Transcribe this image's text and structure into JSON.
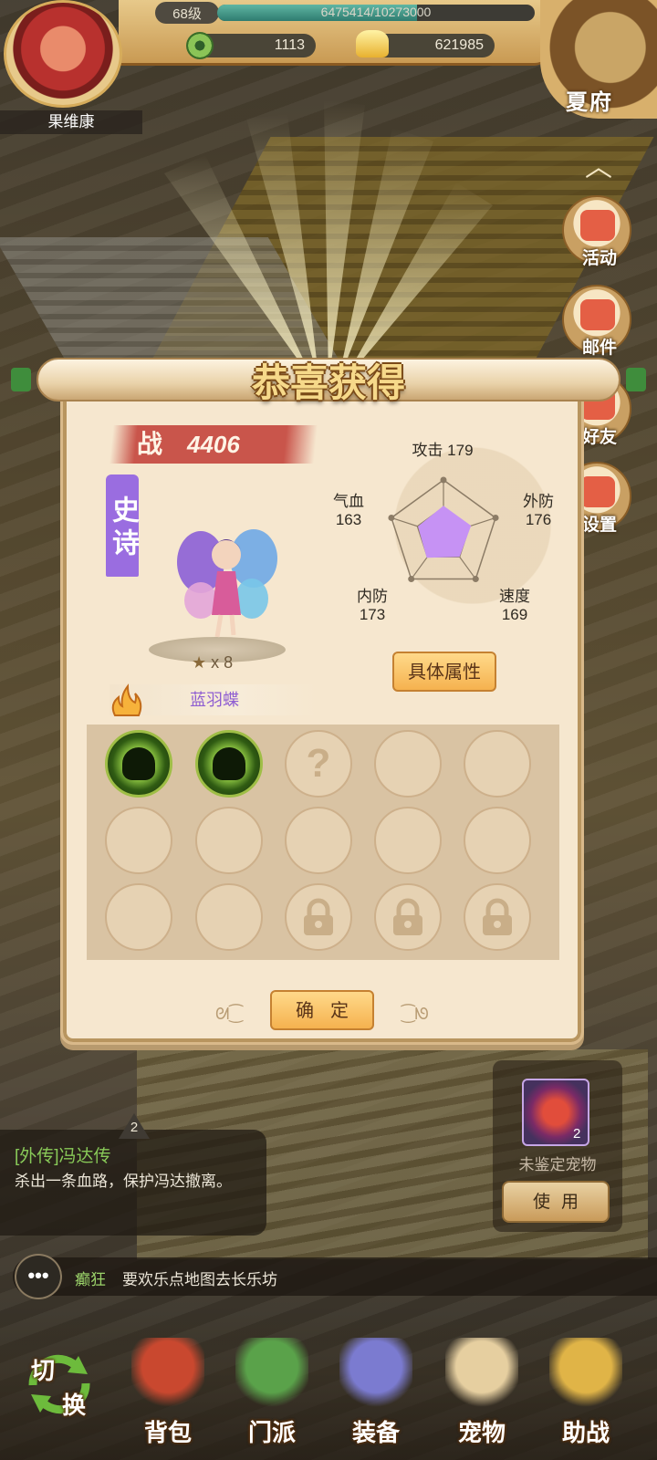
{
  "player": {
    "name": "果维康",
    "level": "68级",
    "exp_text": "6475414/10273000",
    "exp_fraction": 0.63,
    "currency_copper": "1113",
    "currency_gold": "621985"
  },
  "palace": {
    "label": "夏府"
  },
  "side_menu": [
    {
      "label": "活动",
      "icon": "drum-icon"
    },
    {
      "label": "邮件",
      "icon": "envelope-icon"
    },
    {
      "label": "好友",
      "icon": "friends-icon"
    },
    {
      "label": "设置",
      "icon": "gear-icon"
    }
  ],
  "popup": {
    "title": "恭喜获得",
    "power_label": "战",
    "power_value": "4406",
    "rarity": "史诗",
    "stars": "x 8",
    "pet_name": "蓝羽蝶",
    "stats": {
      "attack": {
        "label": "攻击",
        "value": "179"
      },
      "outer_defense": {
        "label": "外防",
        "value": "176"
      },
      "speed": {
        "label": "速度",
        "value": "169"
      },
      "inner_defense": {
        "label": "内防",
        "value": "173"
      },
      "hp": {
        "label": "气血",
        "value": "163"
      }
    },
    "radar_fraction": {
      "attack": 0.53,
      "outer_defense": 0.53,
      "speed": 0.5,
      "inner_defense": 0.52,
      "hp": 0.49
    },
    "attr_button": "具体属性",
    "confirm_button": "确定",
    "skills": {
      "rows": [
        [
          "skill",
          "skill",
          "unknown",
          "empty",
          "empty"
        ],
        [
          "empty",
          "empty",
          "empty",
          "empty",
          "empty"
        ],
        [
          "empty",
          "empty",
          "locked",
          "locked",
          "locked"
        ]
      ]
    }
  },
  "quest": {
    "badge": "2",
    "title": "[外传]冯达传",
    "desc": "杀出一条血路，保护冯达撤离。"
  },
  "pet_item": {
    "count": "2",
    "label": "未鉴定宠物",
    "use_button": "使用"
  },
  "chat": {
    "speaker": "癫狂",
    "text": "要欢乐点地图去长乐坊"
  },
  "nav": {
    "switch_top": "切",
    "switch_bottom": "换",
    "items": [
      {
        "label": "背包",
        "icon": "bag-icon",
        "color": "#c9482f"
      },
      {
        "label": "门派",
        "icon": "sect-icon",
        "color": "#5aa24a"
      },
      {
        "label": "装备",
        "icon": "sword-icon",
        "color": "#7b7bd0"
      },
      {
        "label": "宠物",
        "icon": "cat-icon",
        "color": "#e6cfa0"
      },
      {
        "label": "助战",
        "icon": "helmet-icon",
        "color": "#e0b447"
      }
    ]
  },
  "colors": {
    "accent": "#f5b24f",
    "epic": "#9a6de0",
    "radar_fill": "#c692f4"
  }
}
